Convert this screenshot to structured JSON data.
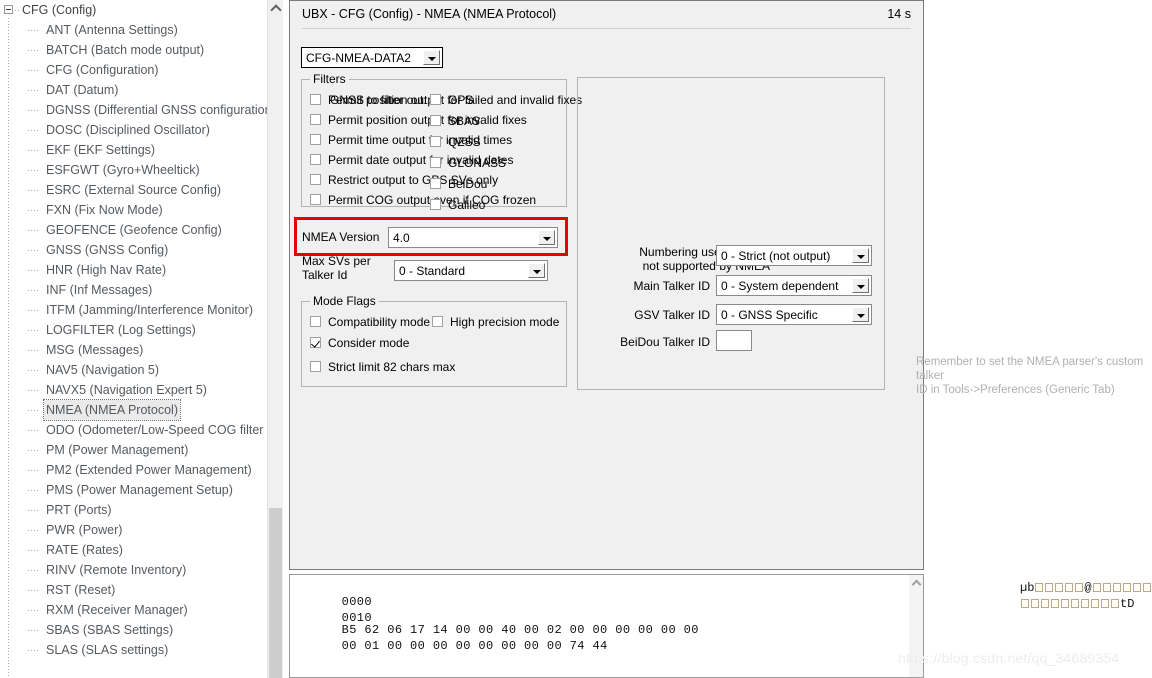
{
  "tree": {
    "root": {
      "label": "CFG (Config)",
      "expander": "minus-box-icon"
    },
    "items": [
      {
        "label": "ANT (Antenna Settings)"
      },
      {
        "label": "BATCH (Batch mode output)"
      },
      {
        "label": "CFG (Configuration)"
      },
      {
        "label": "DAT (Datum)"
      },
      {
        "label": "DGNSS (Differential GNSS configuration"
      },
      {
        "label": "DOSC (Disciplined Oscillator)"
      },
      {
        "label": "EKF (EKF Settings)"
      },
      {
        "label": "ESFGWT (Gyro+Wheeltick)"
      },
      {
        "label": "ESRC (External Source Config)"
      },
      {
        "label": "FXN (Fix Now Mode)"
      },
      {
        "label": "GEOFENCE (Geofence Config)"
      },
      {
        "label": "GNSS (GNSS Config)"
      },
      {
        "label": "HNR (High Nav Rate)"
      },
      {
        "label": "INF (Inf Messages)"
      },
      {
        "label": "ITFM (Jamming/Interference Monitor)"
      },
      {
        "label": "LOGFILTER (Log Settings)"
      },
      {
        "label": "MSG (Messages)"
      },
      {
        "label": "NAV5 (Navigation 5)"
      },
      {
        "label": "NAVX5 (Navigation Expert 5)"
      },
      {
        "label": "NMEA (NMEA Protocol)",
        "selected": true
      },
      {
        "label": "ODO (Odometer/Low-Speed COG filter"
      },
      {
        "label": "PM (Power Management)"
      },
      {
        "label": "PM2 (Extended Power Management)"
      },
      {
        "label": "PMS (Power Management Setup)"
      },
      {
        "label": "PRT (Ports)"
      },
      {
        "label": "PWR (Power)"
      },
      {
        "label": "RATE (Rates)"
      },
      {
        "label": "RINV (Remote Inventory)"
      },
      {
        "label": "RST (Reset)"
      },
      {
        "label": "RXM (Receiver Manager)"
      },
      {
        "label": "SBAS (SBAS Settings)"
      },
      {
        "label": "SLAS (SLAS settings)"
      }
    ]
  },
  "panel": {
    "title": "UBX - CFG (Config) - NMEA (NMEA Protocol)",
    "timer": "14 s",
    "message_combo": {
      "value": "CFG-NMEA-DATA2"
    }
  },
  "filters": {
    "title": "Filters",
    "items": [
      {
        "label": "Permit position output for failed and invalid fixes",
        "checked": false
      },
      {
        "label": "Permit position output for invalid fixes",
        "checked": false
      },
      {
        "label": "Permit time output for invalid times",
        "checked": false
      },
      {
        "label": "Permit date output for invalid dates",
        "checked": false
      },
      {
        "label": "Restrict output to GPS SVs only",
        "checked": false
      },
      {
        "label": "Permit COG output even if COG frozen",
        "checked": false
      }
    ]
  },
  "nmea_version": {
    "label": "NMEA Version",
    "value": "4.0",
    "highlight_color": "#e60000"
  },
  "max_svs": {
    "label_line1": "Max SVs per",
    "label_line2": "Talker Id",
    "value": "0 - Standard"
  },
  "mode_flags": {
    "title": "Mode Flags",
    "items": [
      {
        "label": "Compatibility mode",
        "checked": false
      },
      {
        "label": "High precision mode",
        "checked": false
      },
      {
        "label": "Consider mode",
        "checked": true
      },
      {
        "label": "Strict limit 82 chars max",
        "checked": false
      }
    ]
  },
  "gnss_filter": {
    "label": "GNSS to filter out:",
    "items": [
      {
        "label": "GPS",
        "checked": false
      },
      {
        "label": "SBAS",
        "checked": false
      },
      {
        "label": "QZSS",
        "checked": false
      },
      {
        "label": "GLONASS",
        "checked": false
      },
      {
        "label": "BeiDou",
        "checked": false
      },
      {
        "label": "Galileo",
        "checked": false
      }
    ]
  },
  "talker": {
    "numbering_label_line1": "Numbering used for SVs",
    "numbering_label_line2": "not supported by NMEA",
    "numbering_value": "0 - Strict (not output)",
    "main_label": "Main Talker ID",
    "main_value": "0 - System dependent",
    "gsv_label": "GSV Talker ID",
    "gsv_value": "0 - GNSS Specific",
    "beidou_label": "BeiDou Talker ID",
    "beidou_value": "",
    "note_line1": "Remember to set the NMEA parser's custom talker",
    "note_line2": "ID in Tools->Preferences (Generic Tab)"
  },
  "hex_dump": {
    "line1_offset": "0000",
    "line1_bytes": "B5 62 06 17 14 00 00 40 00 02 00 00 00 00 00 00",
    "line2_offset": "0010",
    "line2_bytes": "00 01 00 00 00 00 00 00 00 00 74 44",
    "line1_ascii_prefix": "µb",
    "line1_ascii_mid": "@",
    "line2_ascii_suffix": "tD"
  },
  "watermark": {
    "text": "https://blog.csdn.net/qq_34689354"
  }
}
